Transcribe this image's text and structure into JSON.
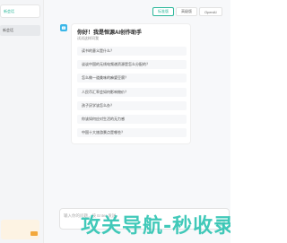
{
  "sidebar": {
    "new_chat_label": "新会话",
    "history_items": [
      {
        "label": "新会话"
      }
    ],
    "promo": {
      "title": "",
      "subtitle": ""
    }
  },
  "header": {
    "model_tabs": [
      {
        "label": "标准版",
        "active": true
      },
      {
        "label": "高级版",
        "active": false
      },
      {
        "label": "OpenAI",
        "active": false
      }
    ]
  },
  "welcome": {
    "title": "你好！我是恒源AI创作助手",
    "subtitle": "试试这样问我",
    "questions": [
      "读书的意义是什么？",
      "谈谈中国的无线电频谱资源是怎么分配的？",
      "怎么做一道美味的麻婆豆腐？",
      "人民币汇率会如何影响物价？",
      "孩子厌学该怎么办？",
      "你该如何应对生活的无力感",
      "中国十大旅游景点是哪些？"
    ]
  },
  "input": {
    "placeholder": "输入你的问题，按 Enter 发送"
  },
  "watermark": {
    "text": "攻关导航-秒收录"
  },
  "colors": {
    "accent": "#2bb79a",
    "avatar": "#3ab6e8",
    "watermark": "#27c2b0"
  }
}
